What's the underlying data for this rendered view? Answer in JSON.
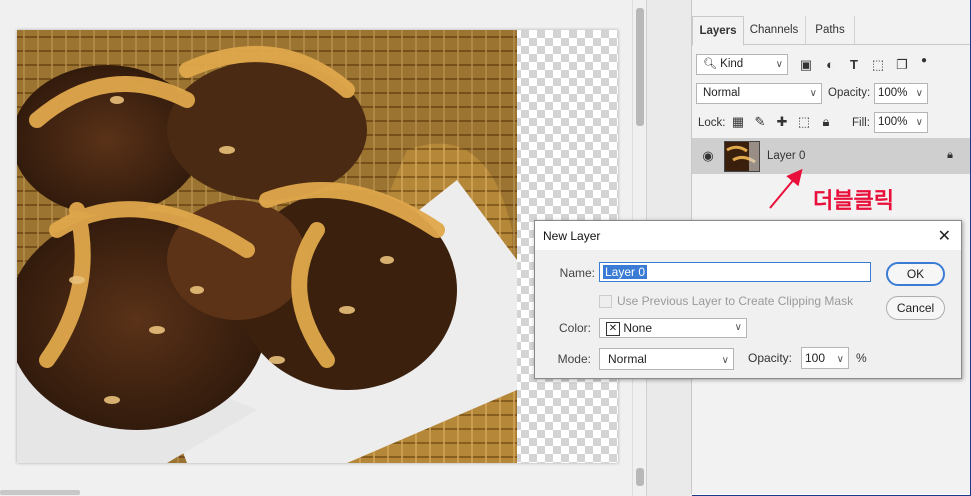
{
  "panel": {
    "tabs": [
      {
        "label": "Layers"
      },
      {
        "label": "Channels"
      },
      {
        "label": "Paths"
      }
    ],
    "filter_kind": "Kind",
    "blend_mode": "Normal",
    "opacity_label": "Opacity:",
    "opacity_value": "100%",
    "lock_label": "Lock:",
    "fill_label": "Fill:",
    "fill_value": "100%",
    "layer_name": "Layer 0"
  },
  "annotation": {
    "text": "더블클릭",
    "color": "#e8103a"
  },
  "dialog": {
    "title": "New Layer",
    "name_label": "Name:",
    "name_value": "Layer 0",
    "clipping_label": "Use Previous Layer to Create Clipping Mask",
    "color_label": "Color:",
    "color_value": "None",
    "mode_label": "Mode:",
    "mode_value": "Normal",
    "opacity_label": "Opacity:",
    "opacity_value": "100",
    "opacity_unit": "%",
    "ok_label": "OK",
    "cancel_label": "Cancel",
    "accent_color": "#3a7bd5"
  },
  "icons": [
    "eye-icon",
    "lock-icon",
    "image-filter-icon",
    "adjustment-filter-icon",
    "type-filter-icon",
    "shape-filter-icon",
    "smartobject-filter-icon",
    "close-icon",
    "checkerboard-lock-icon",
    "brush-lock-icon",
    "move-lock-icon",
    "artboard-lock-icon",
    "padlock-icon",
    "search-icon"
  ]
}
